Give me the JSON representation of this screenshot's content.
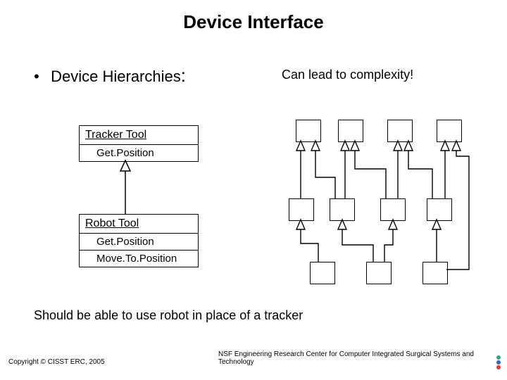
{
  "title": "Device Interface",
  "bullet": {
    "dot": "•",
    "text": "Device Hierarchies",
    "colon": ":"
  },
  "complexity": "Can lead to complexity!",
  "classes": {
    "tracker": {
      "name": "Tracker Tool",
      "ops": [
        "Get.Position"
      ]
    },
    "robot": {
      "name": "Robot Tool",
      "ops": [
        "Get.Position",
        "Move.To.Position"
      ]
    }
  },
  "should": "Should be able to use robot in place of a tracker",
  "copyright": "Copyright © CISST ERC, 2005",
  "center_credit": "NSF Engineering Research Center for Computer Integrated Surgical Systems and Technology",
  "chart_data": {
    "type": "diagram",
    "description": "UML-style inheritance on left: Robot Tool (Get.Position, Move.To.Position) is a subclass of Tracker Tool (Get.Position). Right: tangled hierarchy graph of 11 empty boxes showing multiple inheritance edges, captioned 'Can lead to complexity!'.",
    "left": {
      "nodes": [
        {
          "id": "TrackerTool",
          "ops": [
            "Get.Position"
          ]
        },
        {
          "id": "RobotTool",
          "ops": [
            "Get.Position",
            "Move.To.Position"
          ]
        }
      ],
      "edges": [
        {
          "from": "RobotTool",
          "to": "TrackerTool",
          "kind": "inherits"
        }
      ]
    },
    "right": {
      "nodes": [
        "t1",
        "t2",
        "t3",
        "t4",
        "m1",
        "m2",
        "m3",
        "m4",
        "b1",
        "b2",
        "b3"
      ],
      "rows": {
        "top": [
          "t1",
          "t2",
          "t3",
          "t4"
        ],
        "mid": [
          "m1",
          "m2",
          "m3",
          "m4"
        ],
        "bot": [
          "b1",
          "b2",
          "b3"
        ]
      },
      "edges": [
        {
          "from": "m1",
          "to": "t1"
        },
        {
          "from": "m2",
          "to": "t2"
        },
        {
          "from": "m2",
          "to": "t1"
        },
        {
          "from": "m3",
          "to": "t2"
        },
        {
          "from": "m3",
          "to": "t3"
        },
        {
          "from": "m4",
          "to": "t3"
        },
        {
          "from": "m4",
          "to": "t4"
        },
        {
          "from": "b1",
          "to": "m1"
        },
        {
          "from": "b2",
          "to": "m2"
        },
        {
          "from": "b2",
          "to": "m3"
        },
        {
          "from": "b3",
          "to": "m4"
        },
        {
          "from": "b3",
          "to": "t4"
        }
      ]
    }
  }
}
